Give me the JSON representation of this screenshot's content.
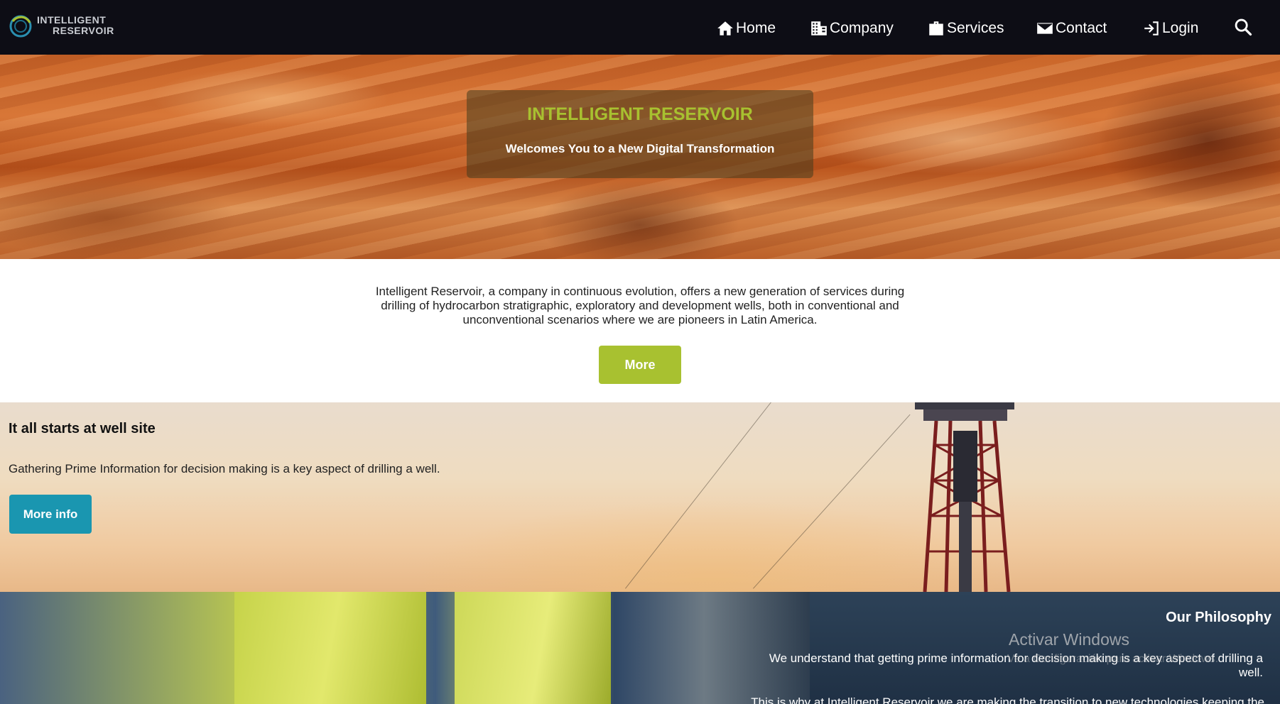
{
  "brand": {
    "logo_line1": "INTELLIGENT",
    "logo_line2": "RESERVOIR"
  },
  "nav": {
    "items": [
      {
        "label": "Home",
        "icon": "home-icon"
      },
      {
        "label": "Company",
        "icon": "building-icon"
      },
      {
        "label": "Services",
        "icon": "briefcase-icon"
      },
      {
        "label": "Contact",
        "icon": "envelope-icon"
      },
      {
        "label": "Login",
        "icon": "login-icon"
      }
    ],
    "search_icon": "search-icon"
  },
  "hero": {
    "title": "INTELLIGENT RESERVOIR",
    "subtitle": "Welcomes You to a New Digital Transformation"
  },
  "intro": {
    "text": "Intelligent Reservoir, a company in continuous evolution, offers a new generation of services during drilling of hydrocarbon stratigraphic, exploratory and development wells, both in conventional and unconventional scenarios where we are pioneers in Latin America.",
    "button_label": "More"
  },
  "well_site": {
    "title": "It all starts at well site",
    "text": "Gathering Prime Information for decision making is a key aspect of drilling a well.",
    "button_label": "More info"
  },
  "philosophy": {
    "title": "Our Philosophy",
    "text": "We understand that getting prime information for decision making is a key aspect of drilling a well.",
    "text2": "This is why at Intelligent Reservoir we are making the transition to new technologies keeping the"
  },
  "watermark": {
    "title": "Activar Windows",
    "subtitle": "Ve a Configuración para activar Windows."
  },
  "colors": {
    "nav_bg": "#0d0d15",
    "accent_green": "#a8c130",
    "accent_teal": "#1a96b0"
  }
}
